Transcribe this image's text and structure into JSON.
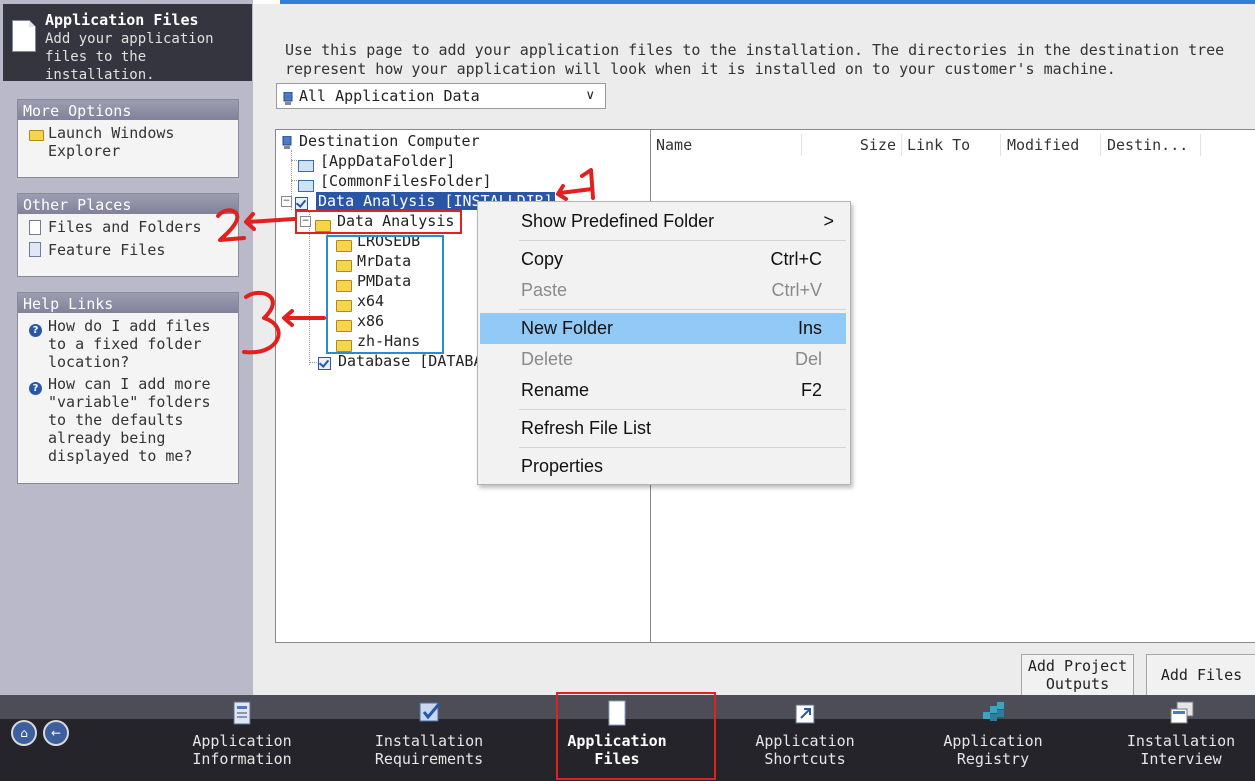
{
  "header": {
    "title": "Application Files",
    "description": "Add your application files to the installation."
  },
  "more_options": {
    "title": "More Options",
    "items": [
      "Launch Windows Explorer"
    ]
  },
  "other_places": {
    "title": "Other Places",
    "items": [
      "Files and Folders",
      "Feature Files"
    ]
  },
  "help_links": {
    "title": "Help Links",
    "items": [
      "How do I add files to a fixed folder location?",
      "How can I add more \"variable\" folders to the defaults already being displayed to me?"
    ]
  },
  "instructions": {
    "line1": "Use this page to add your application files to the installation. The directories in the destination tree",
    "line2": "represent how your application will look when it is installed on to your customer's machine."
  },
  "filter": {
    "selected": "All Application Data"
  },
  "tree": {
    "root": "Destination Computer",
    "app_data": "[AppDataFolder]",
    "common_files": "[CommonFilesFolder]",
    "installdir": "Data Analysis [INSTALLDIR]",
    "data_analysis": "Data Analysis",
    "children": [
      "LROSEDB",
      "MrData",
      "PMData",
      "x64",
      "x86",
      "zh-Hans"
    ],
    "database": "Database [DATABASE]"
  },
  "file_list": {
    "columns": [
      "Name",
      "Size",
      "Link To",
      "Modified",
      "Destin..."
    ]
  },
  "context_menu": {
    "show_predefined": "Show Predefined Folder",
    "show_predefined_arrow": ">",
    "copy": "Copy",
    "copy_sc": "Ctrl+C",
    "paste": "Paste",
    "paste_sc": "Ctrl+V",
    "new_folder": "New Folder",
    "new_folder_sc": "Ins",
    "delete": "Delete",
    "delete_sc": "Del",
    "rename": "Rename",
    "rename_sc": "F2",
    "refresh": "Refresh File List",
    "properties": "Properties"
  },
  "buttons": {
    "add_project_outputs_line1": "Add Project",
    "add_project_outputs_line2": "Outputs",
    "add_files": "Add Files"
  },
  "bottom_nav": {
    "app_info_1": "Application",
    "app_info_2": "Information",
    "inst_req_1": "Installation",
    "inst_req_2": "Requirements",
    "app_files_1": "Application",
    "app_files_2": "Files",
    "app_short_1": "Application",
    "app_short_2": "Shortcuts",
    "app_reg_1": "Application",
    "app_reg_2": "Registry",
    "inst_int_1": "Installation",
    "inst_int_2": "Interview"
  },
  "annotations": {
    "n1": "1",
    "n2": "2",
    "n3": "3"
  },
  "colors": {
    "accent_blue": "#2f7fd6",
    "menu_highlight": "#91c9f7",
    "annotation_red": "#e12020",
    "annotation_blue": "#2a8bd0"
  }
}
